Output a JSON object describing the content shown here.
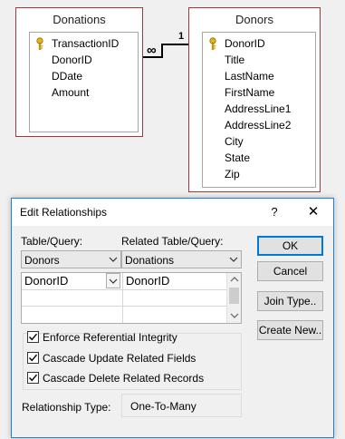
{
  "diagram": {
    "donations_table": {
      "title": "Donations",
      "fields": [
        "TransactionID",
        "DonorID",
        "DDate",
        "Amount"
      ],
      "key_field": "TransactionID"
    },
    "donors_table": {
      "title": "Donors",
      "fields": [
        "DonorID",
        "Title",
        "LastName",
        "FirstName",
        "AddressLine1",
        "AddressLine2",
        "City",
        "State",
        "Zip"
      ],
      "key_field": "DonorID"
    },
    "relationship": {
      "many_symbol": "∞",
      "one_symbol": "1"
    }
  },
  "dialog": {
    "title": "Edit Relationships",
    "help_label": "?",
    "close_label": "✕",
    "table_query_label": "Table/Query:",
    "related_table_query_label": "Related Table/Query:",
    "table_query_value": "Donors",
    "related_table_query_value": "Donations",
    "grid": {
      "rows": [
        {
          "left": "DonorID",
          "right": "DonorID"
        }
      ]
    },
    "checkboxes": {
      "enforce": {
        "label": "Enforce Referential Integrity",
        "checked": true
      },
      "cascade_update": {
        "label": "Cascade Update Related Fields",
        "checked": true
      },
      "cascade_delete": {
        "label": "Cascade Delete Related Records",
        "checked": true
      }
    },
    "relationship_type_label": "Relationship Type:",
    "relationship_type_value": "One-To-Many",
    "buttons": {
      "ok": "OK",
      "cancel": "Cancel",
      "join_type": "Join Type..",
      "create_new": "Create New.."
    }
  }
}
